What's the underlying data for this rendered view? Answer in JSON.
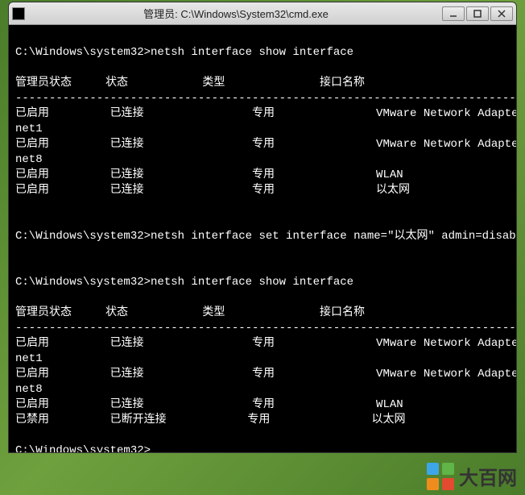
{
  "window": {
    "title": "管理员: C:\\Windows\\System32\\cmd.exe"
  },
  "terminal": {
    "prompt": "C:\\Windows\\system32>",
    "cmd1": "netsh interface show interface",
    "cmd2": "netsh interface set interface name=\"以太网\" admin=disabled",
    "cmd3": "netsh interface show interface",
    "headers": {
      "admin_state": "管理员状态",
      "state": "状态",
      "type": "类型",
      "iface_name": "接口名称"
    },
    "table1": [
      {
        "admin": "已启用",
        "state": "已连接",
        "type": "专用",
        "name": "VMware Network Adapter VM",
        "wrap": "net1"
      },
      {
        "admin": "已启用",
        "state": "已连接",
        "type": "专用",
        "name": "VMware Network Adapter VM",
        "wrap": "net8"
      },
      {
        "admin": "已启用",
        "state": "已连接",
        "type": "专用",
        "name": "WLAN"
      },
      {
        "admin": "已启用",
        "state": "已连接",
        "type": "专用",
        "name": "以太网"
      }
    ],
    "table2": [
      {
        "admin": "已启用",
        "state": "已连接",
        "type": "专用",
        "name": "VMware Network Adapter VM",
        "wrap": "net1"
      },
      {
        "admin": "已启用",
        "state": "已连接",
        "type": "专用",
        "name": "VMware Network Adapter VM",
        "wrap": "net8"
      },
      {
        "admin": "已启用",
        "state": "已连接",
        "type": "专用",
        "name": "WLAN"
      },
      {
        "admin": "已禁用",
        "state": "已断开连接",
        "type": "专用",
        "name": "以太网"
      }
    ]
  },
  "watermark": {
    "text": "大百网"
  }
}
